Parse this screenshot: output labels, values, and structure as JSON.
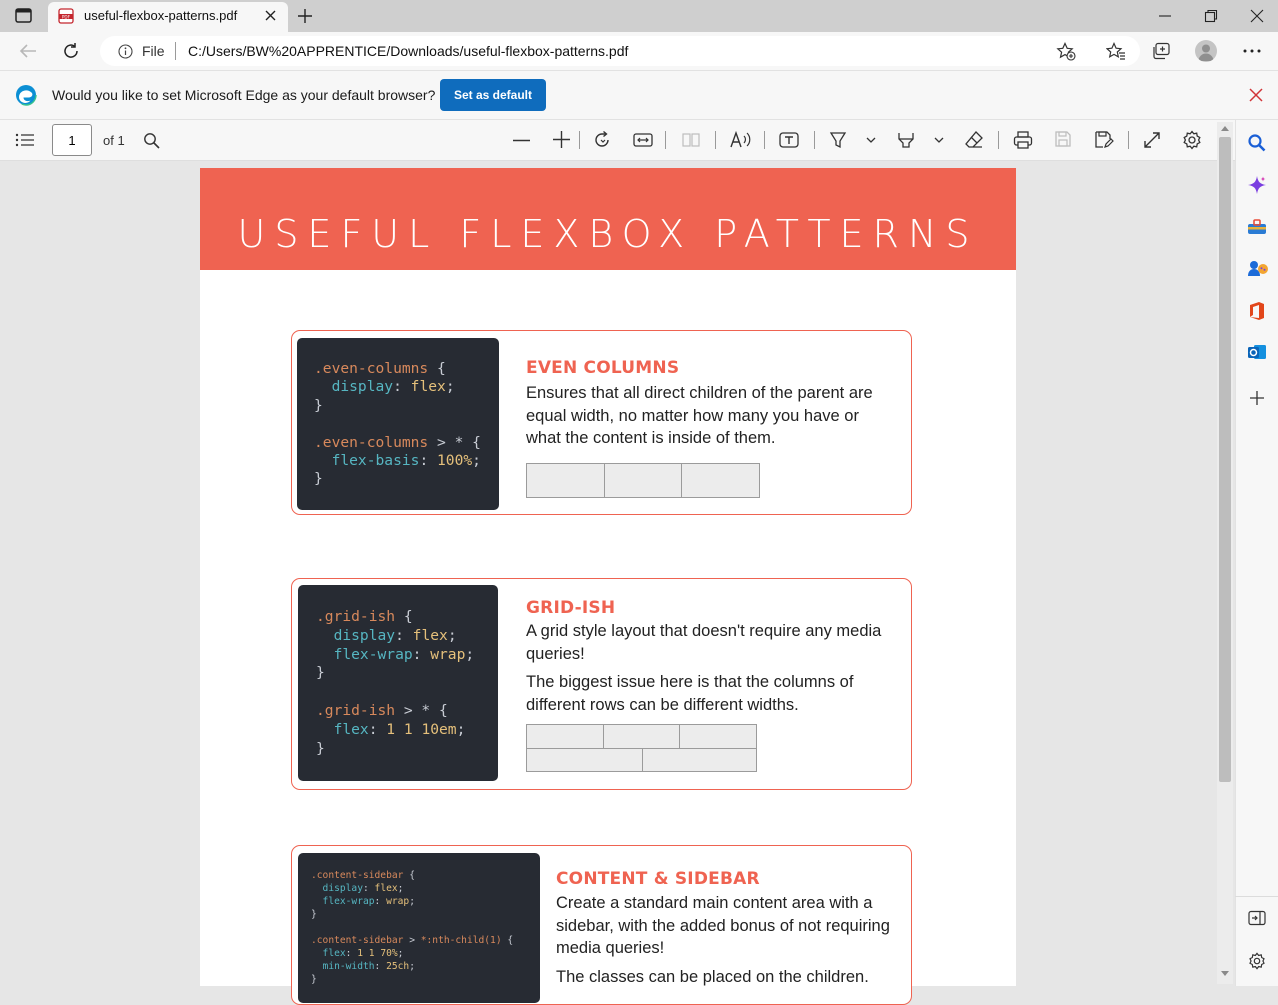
{
  "browser": {
    "tab_title": "useful-flexbox-patterns.pdf",
    "file_label": "File",
    "url": "C:/Users/BW%20APPRENTICE/Downloads/useful-flexbox-patterns.pdf",
    "infobar_text": "Would you like to set Microsoft Edge as your default browser?",
    "set_default_label": "Set as default"
  },
  "pdf_toolbar": {
    "page_number": "1",
    "page_total": "of 1"
  },
  "document": {
    "title": "USEFUL FLEXBOX PATTERNS",
    "cards": [
      {
        "heading": "EVEN COLUMNS",
        "body": [
          "Ensures that all direct children of the parent are equal width, no matter how many you have or what the content is inside of them."
        ],
        "code": [
          [
            {
              "t": ".even-columns",
              "c": "sel"
            },
            {
              "t": " {",
              "c": "pun"
            }
          ],
          [
            {
              "t": "  display",
              "c": "prop"
            },
            {
              "t": ": ",
              "c": "pun"
            },
            {
              "t": "flex",
              "c": "val"
            },
            {
              "t": ";",
              "c": "pun"
            }
          ],
          [
            {
              "t": "}",
              "c": "pun"
            }
          ],
          [],
          [
            {
              "t": ".even-columns",
              "c": "sel"
            },
            {
              "t": " > * {",
              "c": "pun"
            }
          ],
          [
            {
              "t": "  flex-basis",
              "c": "prop"
            },
            {
              "t": ": ",
              "c": "pun"
            },
            {
              "t": "100%",
              "c": "val"
            },
            {
              "t": ";",
              "c": "pun"
            }
          ],
          [
            {
              "t": "}",
              "c": "pun"
            }
          ]
        ]
      },
      {
        "heading": "GRID-ISH",
        "body": [
          "A grid style layout that doesn't require any media queries!",
          "The biggest issue here is that the columns of different rows can be different widths."
        ],
        "code": [
          [
            {
              "t": ".grid-ish",
              "c": "sel"
            },
            {
              "t": " {",
              "c": "pun"
            }
          ],
          [
            {
              "t": "  display",
              "c": "prop"
            },
            {
              "t": ": ",
              "c": "pun"
            },
            {
              "t": "flex",
              "c": "val"
            },
            {
              "t": ";",
              "c": "pun"
            }
          ],
          [
            {
              "t": "  flex-wrap",
              "c": "prop"
            },
            {
              "t": ": ",
              "c": "pun"
            },
            {
              "t": "wrap",
              "c": "val"
            },
            {
              "t": ";",
              "c": "pun"
            }
          ],
          [
            {
              "t": "}",
              "c": "pun"
            }
          ],
          [],
          [
            {
              "t": ".grid-ish",
              "c": "sel"
            },
            {
              "t": " > * {",
              "c": "pun"
            }
          ],
          [
            {
              "t": "  flex",
              "c": "prop"
            },
            {
              "t": ": ",
              "c": "pun"
            },
            {
              "t": "1 1 10em",
              "c": "val"
            },
            {
              "t": ";",
              "c": "pun"
            }
          ],
          [
            {
              "t": "}",
              "c": "pun"
            }
          ]
        ]
      },
      {
        "heading": "CONTENT & SIDEBAR",
        "body": [
          "Create a standard main content area with a sidebar, with the added bonus of not requiring media queries!",
          "The classes can be placed on the children."
        ],
        "code": [
          [
            {
              "t": ".content-sidebar",
              "c": "sel"
            },
            {
              "t": " {",
              "c": "pun"
            }
          ],
          [
            {
              "t": "  display",
              "c": "prop"
            },
            {
              "t": ": ",
              "c": "pun"
            },
            {
              "t": "flex",
              "c": "val"
            },
            {
              "t": ";",
              "c": "pun"
            }
          ],
          [
            {
              "t": "  flex-wrap",
              "c": "prop"
            },
            {
              "t": ": ",
              "c": "pun"
            },
            {
              "t": "wrap",
              "c": "val"
            },
            {
              "t": ";",
              "c": "pun"
            }
          ],
          [
            {
              "t": "}",
              "c": "pun"
            }
          ],
          [],
          [
            {
              "t": ".content-sidebar",
              "c": "sel"
            },
            {
              "t": " > ",
              "c": "pun"
            },
            {
              "t": "*:nth-child(1)",
              "c": "sel"
            },
            {
              "t": " {",
              "c": "pun"
            }
          ],
          [
            {
              "t": "  flex",
              "c": "prop"
            },
            {
              "t": ": ",
              "c": "pun"
            },
            {
              "t": "1 1 70%",
              "c": "val"
            },
            {
              "t": ";",
              "c": "pun"
            }
          ],
          [
            {
              "t": "  min-width",
              "c": "prop"
            },
            {
              "t": ": ",
              "c": "pun"
            },
            {
              "t": "25ch",
              "c": "val"
            },
            {
              "t": ";",
              "c": "pun"
            }
          ],
          [
            {
              "t": "}",
              "c": "pun"
            }
          ]
        ]
      }
    ]
  },
  "colors": {
    "accent": "#ef6351",
    "code_bg": "#272b33",
    "edge_blue": "#0f6cbd"
  },
  "icons": [
    "tab-actions-icon",
    "pdf-file-icon",
    "close-tab-icon",
    "new-tab-icon",
    "minimize-icon",
    "restore-icon",
    "close-window-icon",
    "back-icon",
    "refresh-icon",
    "info-icon",
    "add-favorite-icon",
    "favorites-icon",
    "collections-icon",
    "profile-icon",
    "more-icon",
    "edge-logo-icon",
    "close-infobar-icon",
    "contents-icon",
    "search-icon",
    "zoom-out-icon",
    "zoom-in-icon",
    "rotate-icon",
    "fit-width-icon",
    "page-view-icon",
    "read-aloud-icon",
    "text-icon",
    "draw-icon",
    "highlight-icon",
    "erase-icon",
    "print-icon",
    "save-icon",
    "save-as-icon",
    "fullscreen-icon",
    "settings-icon",
    "search-sidebar-icon",
    "copilot-icon",
    "tools-icon",
    "games-icon",
    "office-icon",
    "outlook-icon",
    "add-sidebar-icon",
    "hide-sidebar-icon",
    "sidebar-settings-icon"
  ]
}
